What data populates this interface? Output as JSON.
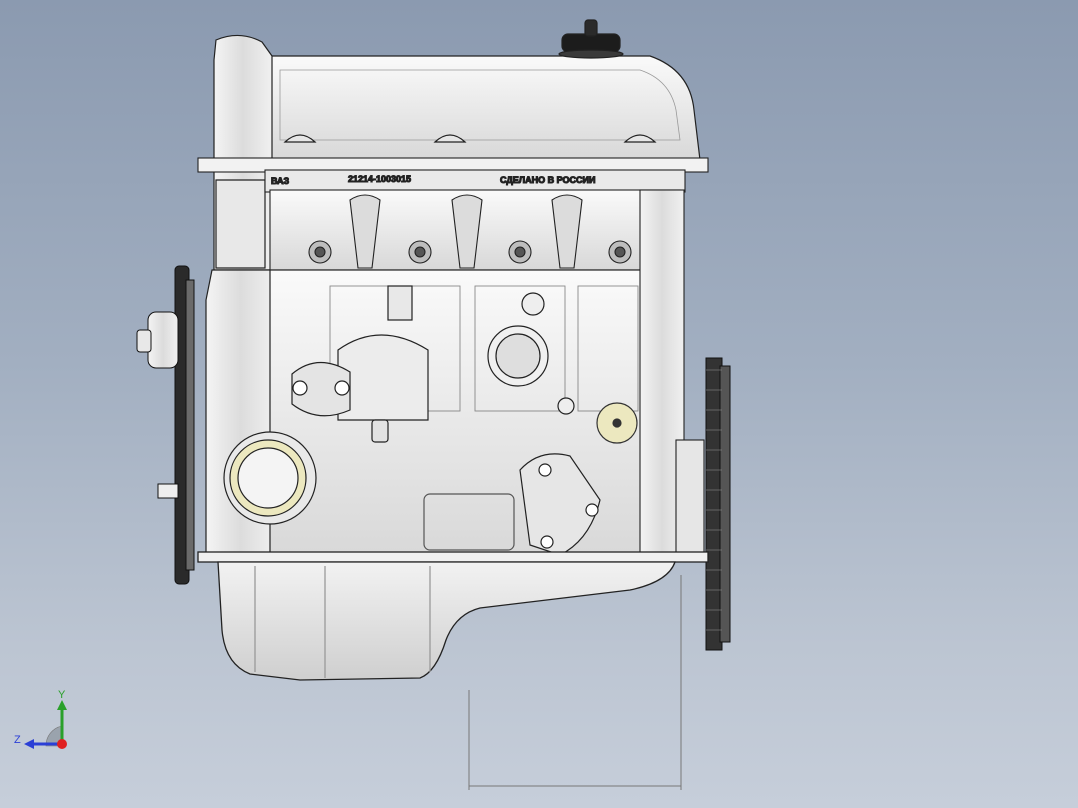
{
  "viewport": {
    "background_top": "#8b9ab0",
    "background_bottom": "#c6ceda"
  },
  "engine": {
    "head_labels": {
      "brand": "ВАЗ",
      "part_number": "21214-1003015",
      "made_in": "СДЕЛАНО В РОССИИ"
    },
    "highlight_color": "#ece8bf"
  },
  "triad": {
    "y_label": "Y",
    "z_label": "Z",
    "y_color": "#2aa02a",
    "z_color": "#2b3fd6",
    "x_color": "#e02020"
  }
}
